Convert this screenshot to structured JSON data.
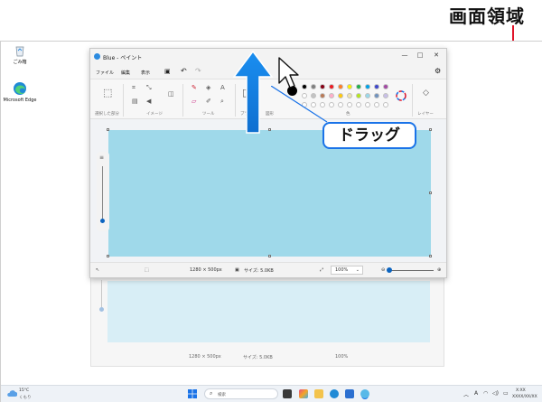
{
  "annotation": {
    "screen_area_label": "画面領域",
    "drag_label": "ドラッグ",
    "accent_red": "#e0142a",
    "accent_blue": "#1a73e8"
  },
  "desktop": {
    "icons": [
      {
        "label": "ごみ箱",
        "icon": "recycle-bin-icon"
      },
      {
        "label": "Microsoft Edge",
        "icon": "edge-icon"
      }
    ]
  },
  "paint_window": {
    "title": "Blue - ペイント",
    "menu": [
      "ファイル",
      "編集",
      "表示"
    ],
    "ribbon_groups": [
      "選択した部分",
      "イメージ",
      "ツール",
      "ブラシ",
      "図形",
      "色",
      "レイヤー"
    ],
    "palette": [
      "#000000",
      "#7f7f7f",
      "#880015",
      "#ed1c24",
      "#ff7f27",
      "#fff200",
      "#22b14c",
      "#00a2e8",
      "#3f48cc",
      "#a349a4",
      "#ffffff",
      "#c3c3c3",
      "#b97a57",
      "#ffaec9",
      "#ffc90e",
      "#efe4b0",
      "#b5e61d",
      "#99d9ea",
      "#7092be",
      "#c8bfe7"
    ],
    "canvas_color": "#9fd9ea",
    "status": {
      "dimensions": "1280 × 500px",
      "size": "サイズ: 5.0KB",
      "zoom": "100%"
    }
  },
  "ghost_window": {
    "dimensions": "1280 × 500px",
    "size": "サイズ: 5.0KB",
    "zoom": "100%"
  },
  "taskbar": {
    "weather_temp": "15°C",
    "weather_desc": "くもり",
    "search_placeholder": "検索",
    "clock_time": "X:XX",
    "clock_date": "XXXX/XX/XX"
  }
}
